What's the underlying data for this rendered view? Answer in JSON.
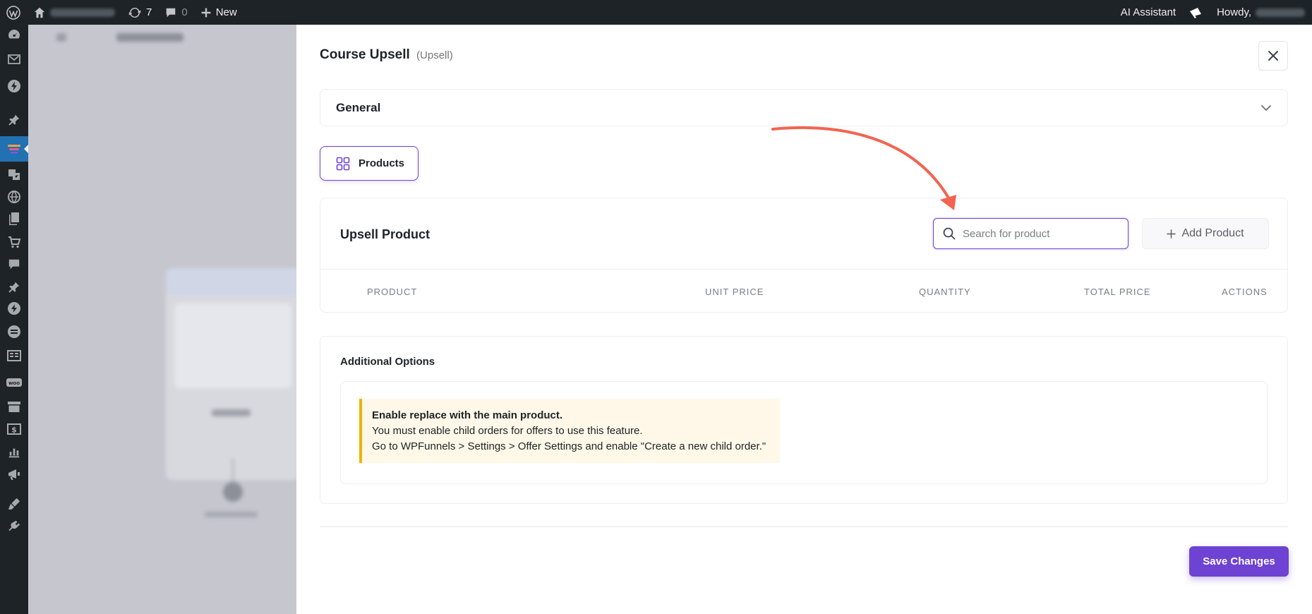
{
  "admin_bar": {
    "updates_count": "7",
    "comments_count": "0",
    "new_label": "New",
    "ai_assistant_label": "AI Assistant",
    "howdy_label": "Howdy,"
  },
  "panel": {
    "title": "Course Upsell",
    "subtitle": "(Upsell)",
    "general_label": "General",
    "products_tab_label": "Products",
    "upsell_title": "Upsell Product",
    "search_placeholder": "Search for product",
    "add_product_label": "Add Product",
    "columns": [
      "PRODUCT",
      "UNIT PRICE",
      "QUANTITY",
      "TOTAL PRICE",
      "ACTIONS"
    ],
    "additional_options_title": "Additional Options",
    "notice": {
      "title": "Enable replace with the main product.",
      "line1": "You must enable child orders for offers to use this feature.",
      "line2": "Go to WPFunnels > Settings > Offer Settings and enable \"Create a new child order.\""
    },
    "save_label": "Save Changes"
  },
  "colors": {
    "accent": "#6e42d3",
    "admin_bar": "#1d2327",
    "notice_border": "#f0b400",
    "annotation_arrow": "#f26450"
  }
}
